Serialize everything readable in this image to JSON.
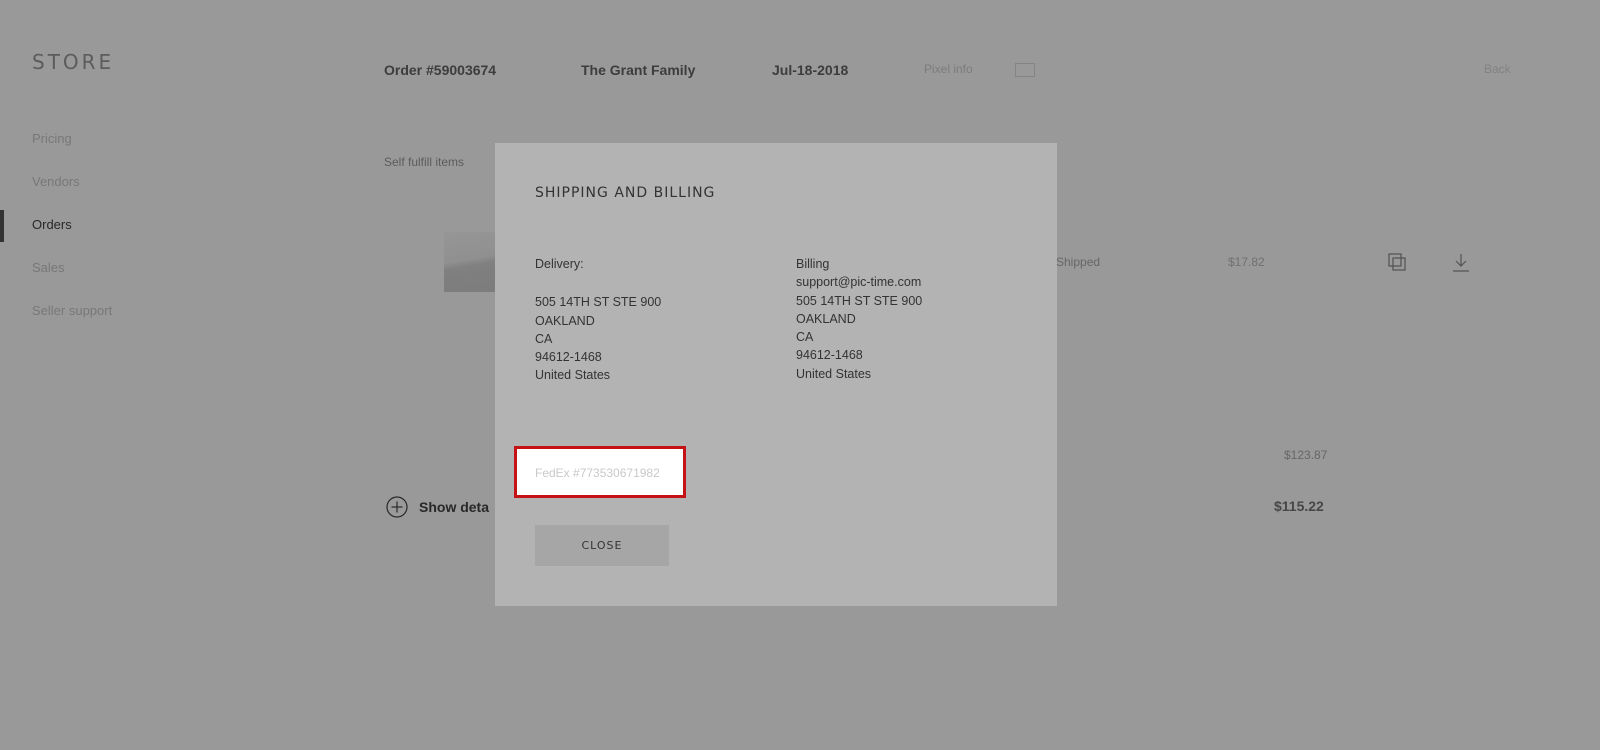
{
  "app": {
    "logo": "STORE"
  },
  "sidebar": {
    "items": [
      {
        "label": "Pricing"
      },
      {
        "label": "Vendors"
      },
      {
        "label": "Orders"
      },
      {
        "label": "Sales"
      },
      {
        "label": "Seller support"
      }
    ],
    "active_index": 2
  },
  "order": {
    "number": "Order #59003674",
    "client": "The Grant Family",
    "date": "Jul-18-2018",
    "pixel_label": "Pixel info",
    "back_label": "Back",
    "section_title": "Self fulfill items",
    "item": {
      "status": "Shipped",
      "price": "$17.82"
    },
    "subtotal": "$123.87",
    "total": "$115.22",
    "show_details_label": "Show deta"
  },
  "modal": {
    "title": "SHIPPING AND BILLING",
    "delivery": {
      "heading": "Delivery:",
      "lines": [
        "505 14TH ST STE 900",
        "OAKLAND",
        "CA",
        "94612-1468",
        "United States"
      ]
    },
    "billing": {
      "heading": "Billing",
      "lines": [
        "support@pic-time.com",
        "505 14TH ST STE 900",
        "OAKLAND",
        "CA",
        "94612-1468",
        "United States"
      ]
    },
    "tracking": "FedEx #773530671982",
    "close_label": "CLOSE"
  },
  "colors": {
    "highlight": "#c41216",
    "overlay": "#000000",
    "modal_bg": "#b3b3b3"
  }
}
